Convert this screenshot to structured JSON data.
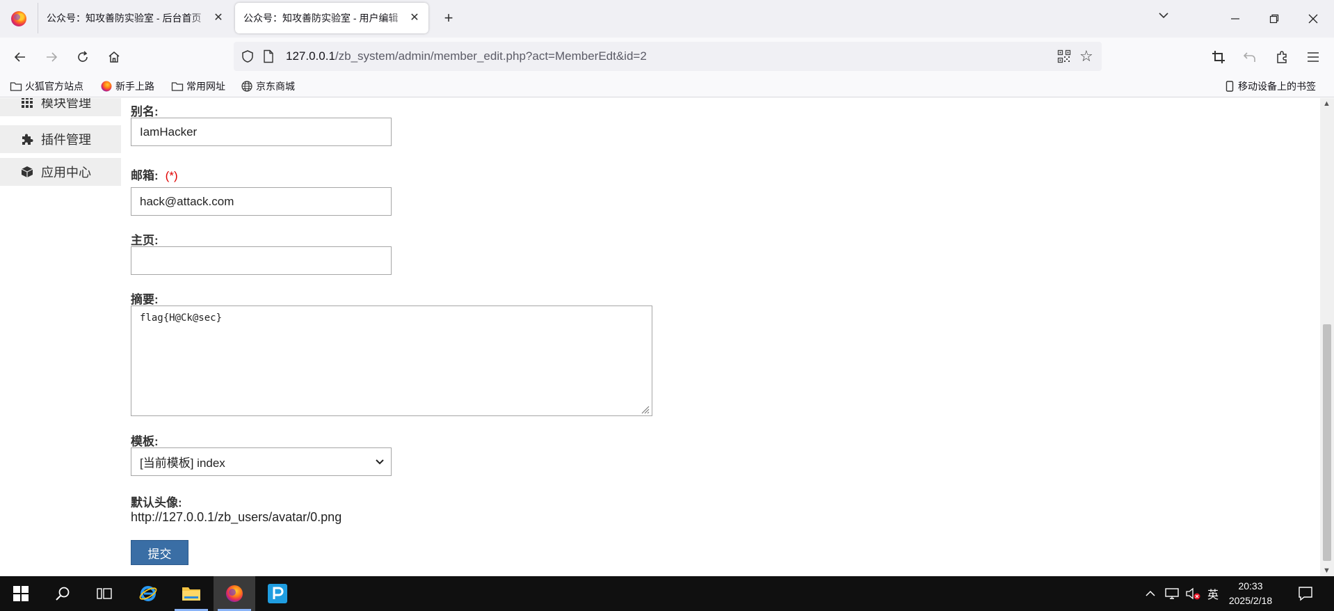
{
  "browser": {
    "tabs": [
      {
        "title": "公众号：知攻善防实验室 - 后台首页"
      },
      {
        "title": "公众号：知攻善防实验室 - 用户编辑"
      }
    ],
    "url": {
      "host": "127.0.0.1",
      "path": "/zb_system/admin/member_edit.php?act=MemberEdt&id=2"
    },
    "bookmarks": [
      "火狐官方站点",
      "新手上路",
      "常用网址",
      "京东商城"
    ],
    "mobile_bookmarks": "移动设备上的书签"
  },
  "sidebar": {
    "items": [
      {
        "label": "模块管理",
        "icon": "grid-icon"
      },
      {
        "label": "插件管理",
        "icon": "puzzle-icon"
      },
      {
        "label": "应用中心",
        "icon": "box-icon"
      }
    ]
  },
  "form": {
    "alias_label": "别名:",
    "alias_value": "IamHacker",
    "email_label": "邮箱:",
    "required_mark": "(*)",
    "email_value": "hack@attack.com",
    "homepage_label": "主页:",
    "homepage_value": "",
    "summary_label": "摘要:",
    "summary_value": "flag{H@Ck@sec}",
    "template_label": "模板:",
    "template_value": "[当前模板] index",
    "avatar_label": "默认头像:",
    "avatar_value": "http://127.0.0.1/zb_users/avatar/0.png",
    "submit_label": "提交"
  },
  "taskbar": {
    "ime": "英",
    "time": "20:33",
    "date": "2025/2/18"
  },
  "colors": {
    "submit_button": "#3a6ea5",
    "required_mark": "#e00000",
    "sidebar_bg": "#eeeeee",
    "taskbar_bg": "#101010"
  }
}
